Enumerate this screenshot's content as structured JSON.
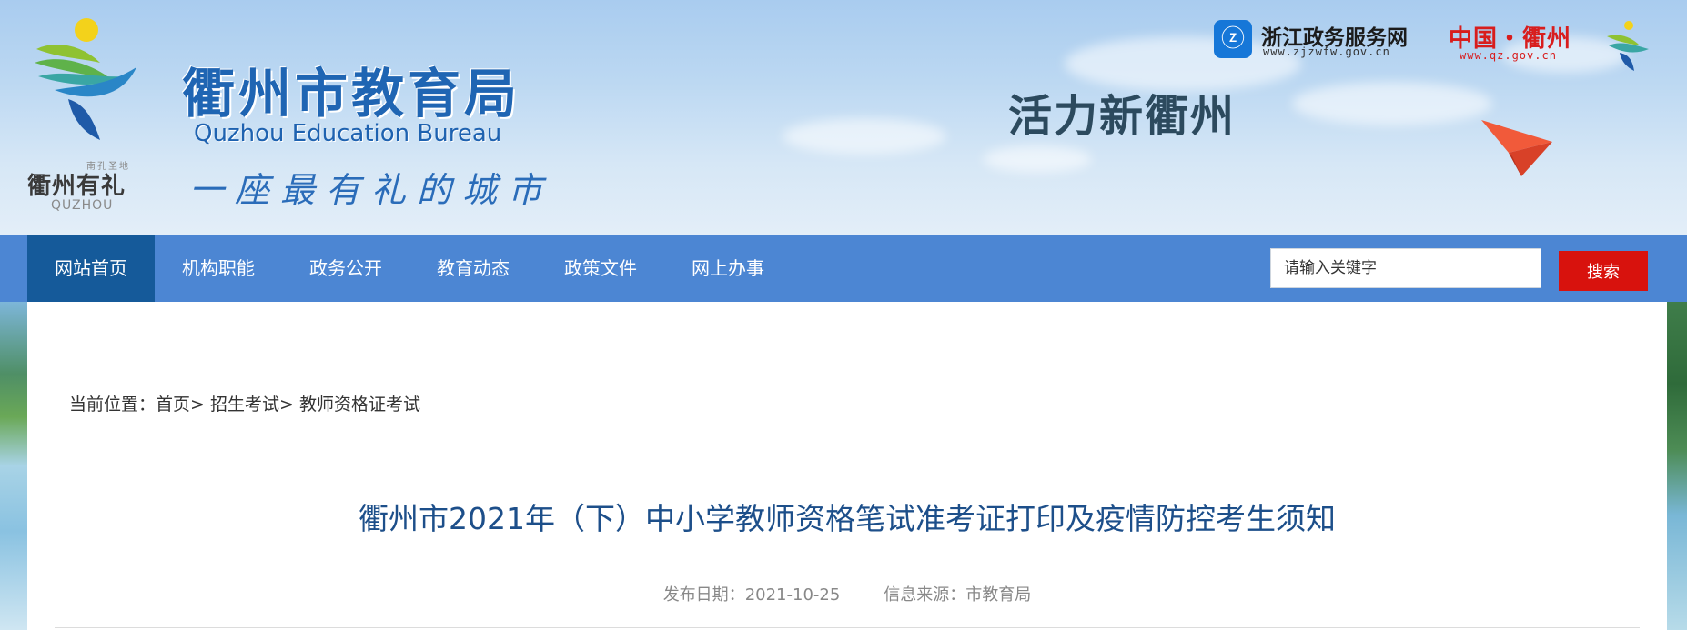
{
  "header": {
    "logo_small_text": "衢州有礼",
    "logo_seal_text": "南孔圣地",
    "logo_en": "QUZHOU",
    "title": "衢州市教育局",
    "subtitle_en": "Quzhou Education Bureau",
    "slogan": "一座最有礼的城市",
    "vitality_text": "活力新衢州",
    "zjzw": {
      "name": "浙江政务服务网",
      "url": "www.zjzwfw.gov.cn"
    },
    "qz": {
      "name": "中国・衢州",
      "url": "www.qz.gov.cn"
    }
  },
  "nav": {
    "items": [
      {
        "label": "网站首页",
        "active": true
      },
      {
        "label": "机构职能",
        "active": false
      },
      {
        "label": "政务公开",
        "active": false
      },
      {
        "label": "教育动态",
        "active": false
      },
      {
        "label": "政策文件",
        "active": false
      },
      {
        "label": "网上办事",
        "active": false
      }
    ],
    "search": {
      "placeholder": "请输入关键字",
      "button_label": "搜索"
    }
  },
  "breadcrumb": {
    "prefix": "当前位置：",
    "items": [
      "首页>",
      "招生考试>",
      "教师资格证考试"
    ]
  },
  "article": {
    "title": "衢州市2021年（下）中小学教师资格笔试准考证打印及疫情防控考生须知",
    "date_label": "发布日期：",
    "date": "2021-10-25",
    "source_label": "信息来源：",
    "source": "市教育局"
  },
  "colors": {
    "nav_bg": "#4c86d3",
    "nav_active": "#155a9a",
    "search_button": "#d8120d",
    "title_blue": "#1f65b3",
    "article_title": "#1d4f8a"
  }
}
